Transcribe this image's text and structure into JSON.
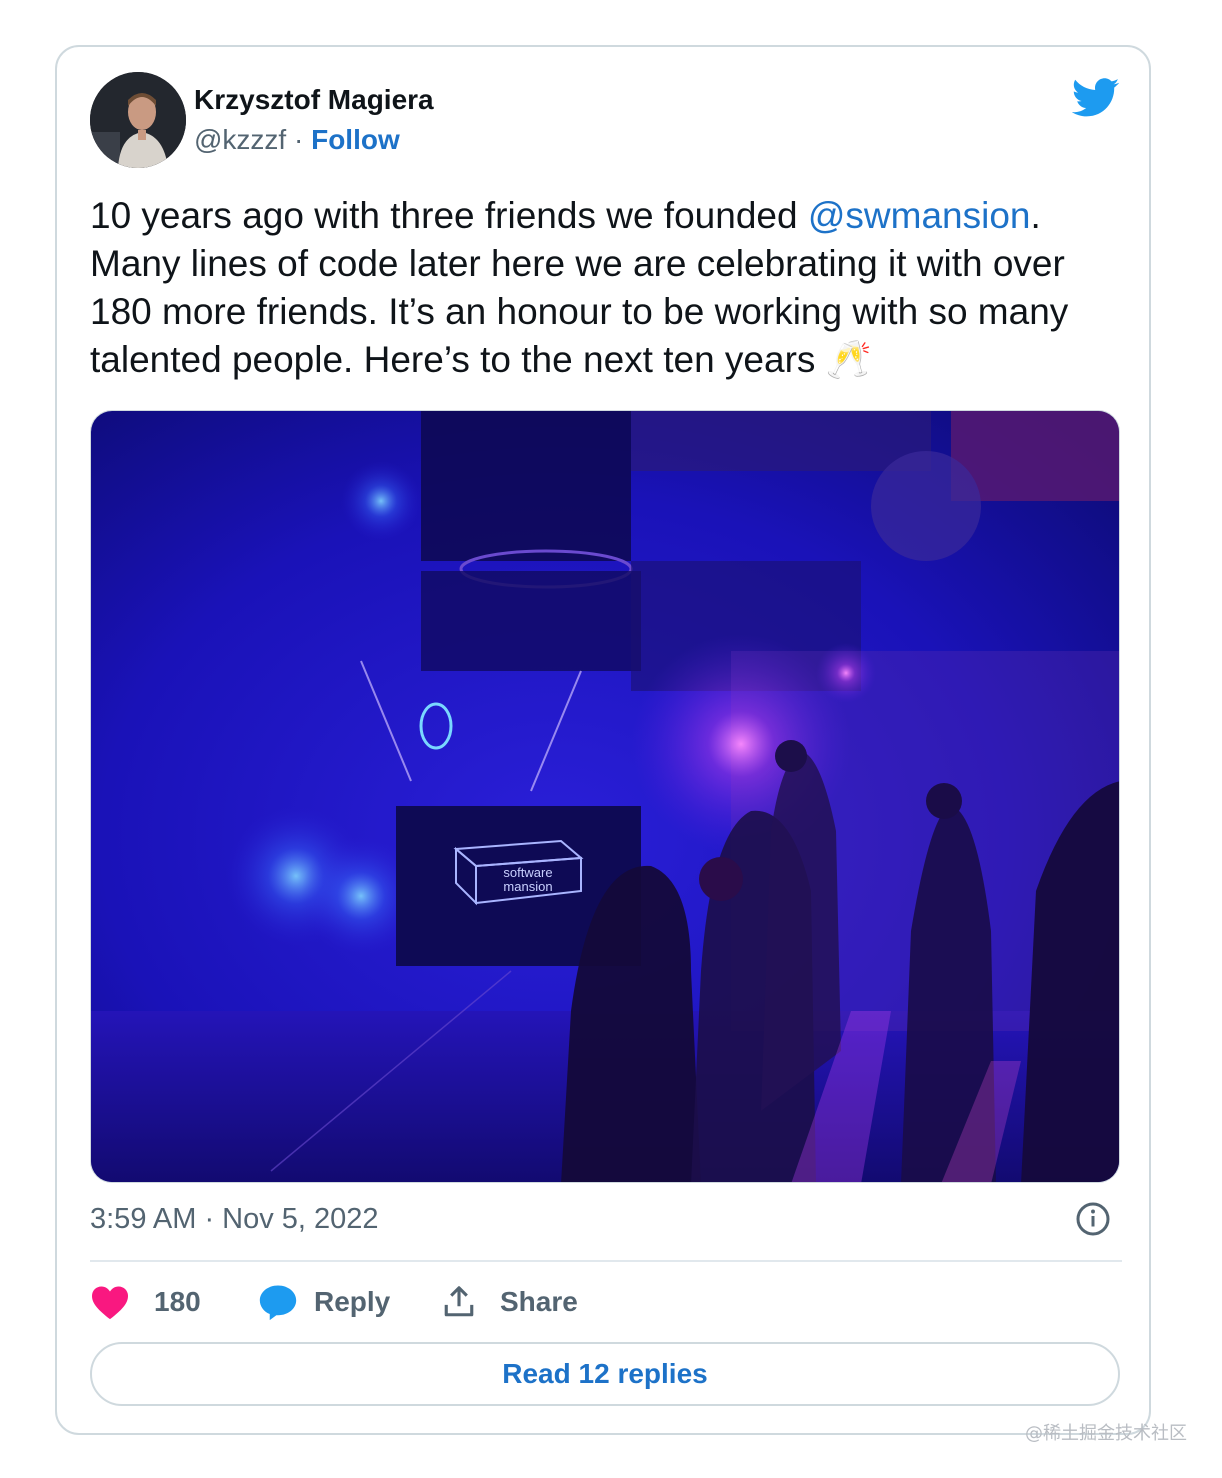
{
  "author": {
    "name": "Krzysztof Magiera",
    "handle": "@kzzzf",
    "separator": "·",
    "follow_label": "Follow"
  },
  "tweet": {
    "text_before_mention": "10 years ago with three friends we founded ",
    "mention": "@swmansion",
    "text_after_mention": ". Many lines of code later here we are celebrating it with over 180 more friends. It’s an honour to be working with so many talented people. Here’s to the next ten years ",
    "emoji": "🥂"
  },
  "media": {
    "sign_line1": "software",
    "sign_line2": "mansion"
  },
  "timestamp": "3:59 AM · Nov 5, 2022",
  "actions": {
    "likes": "180",
    "reply_label": "Reply",
    "share_label": "Share"
  },
  "read_replies_label": "Read 12 replies",
  "watermark": "@稀土掘金技术社区",
  "colors": {
    "link": "#1d72c8",
    "like": "#f91880",
    "reply": "#1d9bf0",
    "muted": "#536471",
    "border": "#cfd9de"
  }
}
